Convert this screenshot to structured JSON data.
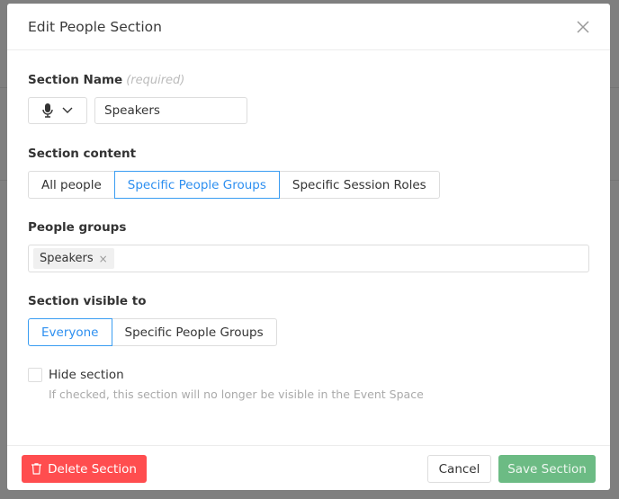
{
  "modal": {
    "title": "Edit People Section"
  },
  "section_name": {
    "label": "Section Name",
    "required": "(required)",
    "icon": "microphone-icon",
    "value": "Speakers"
  },
  "section_content": {
    "label": "Section content",
    "options": [
      "All people",
      "Specific People Groups",
      "Specific Session Roles"
    ],
    "selected": "Specific People Groups"
  },
  "people_groups": {
    "label": "People groups",
    "tags": [
      "Speakers"
    ]
  },
  "visible_to": {
    "label": "Section visible to",
    "options": [
      "Everyone",
      "Specific People Groups"
    ],
    "selected": "Everyone"
  },
  "hide": {
    "label": "Hide section",
    "help": "If checked, this section will no longer be visible in the Event Space",
    "checked": false
  },
  "footer": {
    "delete": "Delete Section",
    "cancel": "Cancel",
    "save": "Save Section"
  },
  "colors": {
    "accent": "#2d8ff0",
    "danger": "#ff4d4f",
    "success": "#6cbb84"
  }
}
